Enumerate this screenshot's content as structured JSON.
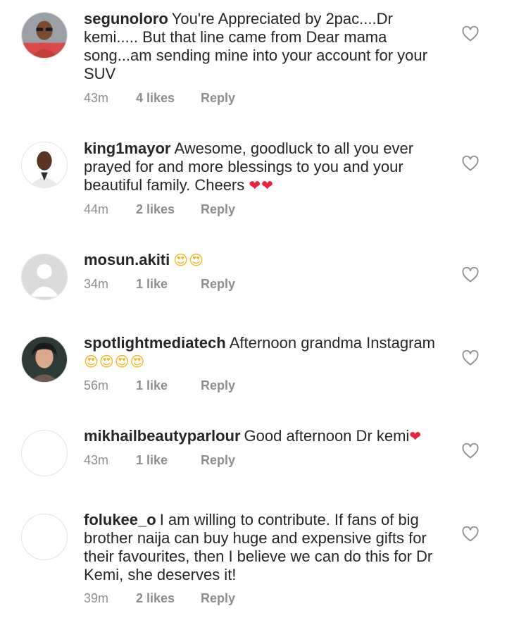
{
  "comments": [
    {
      "username": "segunoloro",
      "text": "You're Appreciated by 2pac....Dr kemi..... But that line came from Dear mama song...am sending mine into your account for your SUV",
      "emoji": "",
      "time": "43m",
      "likes": "4 likes",
      "reply": "Reply",
      "avatar": "photo"
    },
    {
      "username": "king1mayor",
      "text": "Awesome, goodluck to all you ever prayed for and more blessings to you and your beautiful family. Cheers",
      "emoji": "❤❤",
      "time": "44m",
      "likes": "2 likes",
      "reply": "Reply",
      "avatar": "photo"
    },
    {
      "username": "mosun.akiti",
      "text": "",
      "emoji": "😍😍",
      "time": "34m",
      "likes": "1 like",
      "reply": "Reply",
      "avatar": "default"
    },
    {
      "username": "spotlightmediatech",
      "text": "Afternoon  grandma Instagram",
      "emoji": "😍😍😍😍",
      "time": "56m",
      "likes": "1 like",
      "reply": "Reply",
      "avatar": "photo"
    },
    {
      "username": "mikhailbeautyparlour",
      "text": "Good afternoon Dr kemi",
      "emoji": "❤",
      "time": "43m",
      "likes": "1 like",
      "reply": "Reply",
      "avatar": "blank"
    },
    {
      "username": "folukee_o",
      "text": "I am willing to contribute. If fans of big brother naija can buy huge and expensive gifts for their favourites, then I believe we can do this for Dr Kemi, she deserves it!",
      "emoji": "",
      "time": "39m",
      "likes": "2 likes",
      "reply": "Reply",
      "avatar": "blank"
    }
  ],
  "colors": {
    "text": "#262626",
    "secondary": "#8e8e8e",
    "heart_outline": "#8e8e8e",
    "emoji_heart": "#e8233b"
  },
  "icons": {
    "like": "heart-outline-icon"
  }
}
